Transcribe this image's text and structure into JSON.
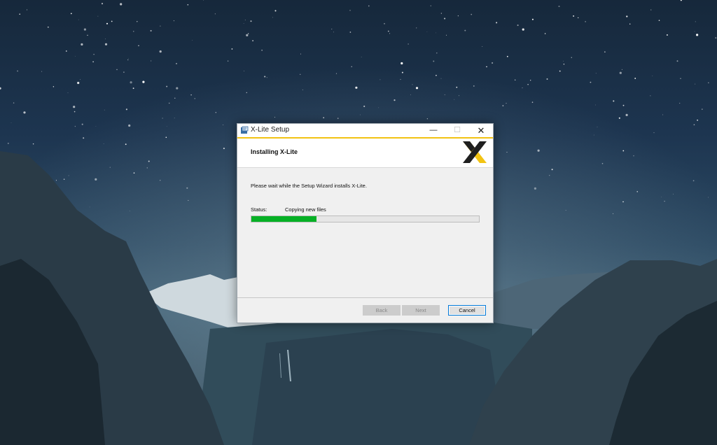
{
  "window": {
    "title": "X-Lite Setup",
    "minimize_glyph": "—",
    "maximize_glyph": "☐",
    "close_glyph": "✕"
  },
  "header": {
    "title": "Installing X-Lite",
    "logo_icon": "x-lite-logo",
    "accent_color": "#f2c313"
  },
  "body": {
    "message": "Please wait while the Setup Wizard installs X-Lite.",
    "status_label": "Status:",
    "status_value": "Copying new files",
    "progress_fraction": 0.285,
    "progress_color": "#06b025"
  },
  "buttons": {
    "back": "Back",
    "next": "Next",
    "cancel": "Cancel"
  }
}
